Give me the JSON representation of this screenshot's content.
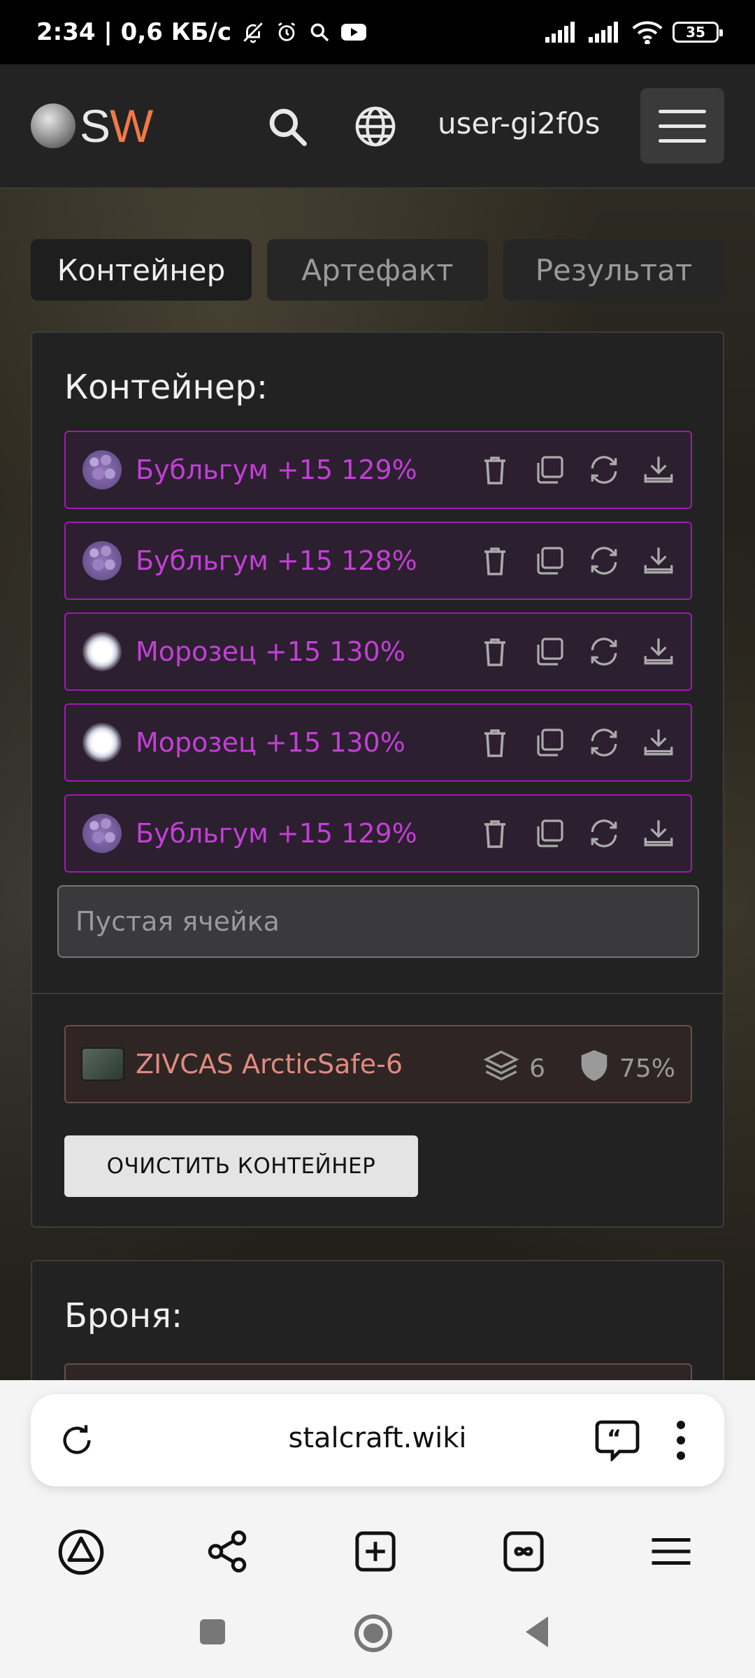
{
  "status_bar": {
    "time_info": "2:34 | 0,6 КБ/с",
    "battery": "35"
  },
  "header": {
    "logo_s": "S",
    "logo_w": "W",
    "username": "user-gi2f0s"
  },
  "tabs": [
    {
      "label": "Контейнер",
      "active": true
    },
    {
      "label": "Артефакт",
      "active": false
    },
    {
      "label": "Результат",
      "active": false
    }
  ],
  "container_section": {
    "title": "Контейнер:",
    "slots": [
      {
        "label": "Бубльгум +15 129%",
        "icon": "bubblegum-artifact-icon"
      },
      {
        "label": "Бубльгум +15 128%",
        "icon": "bubblegum-artifact-icon"
      },
      {
        "label": "Морозец +15 130%",
        "icon": "frost-artifact-icon"
      },
      {
        "label": "Морозец +15 130%",
        "icon": "frost-artifact-icon"
      },
      {
        "label": "Бубльгум +15 129%",
        "icon": "bubblegum-artifact-icon"
      }
    ],
    "empty_cell_placeholder": "Пустая ячейка",
    "container": {
      "name": "ZIVCAS ArcticSafe-6",
      "capacity": "6",
      "protection": "75%"
    },
    "clear_button": "ОЧИСТИТЬ КОНТЕЙНЕР"
  },
  "armor_section": {
    "title": "Броня:"
  },
  "browser": {
    "url": "stalcraft.wiki"
  },
  "colors": {
    "accent": "#f07a45",
    "slot_border": "#a416b8",
    "slot_text": "#c23fd6",
    "container_text": "#e08a7e"
  }
}
